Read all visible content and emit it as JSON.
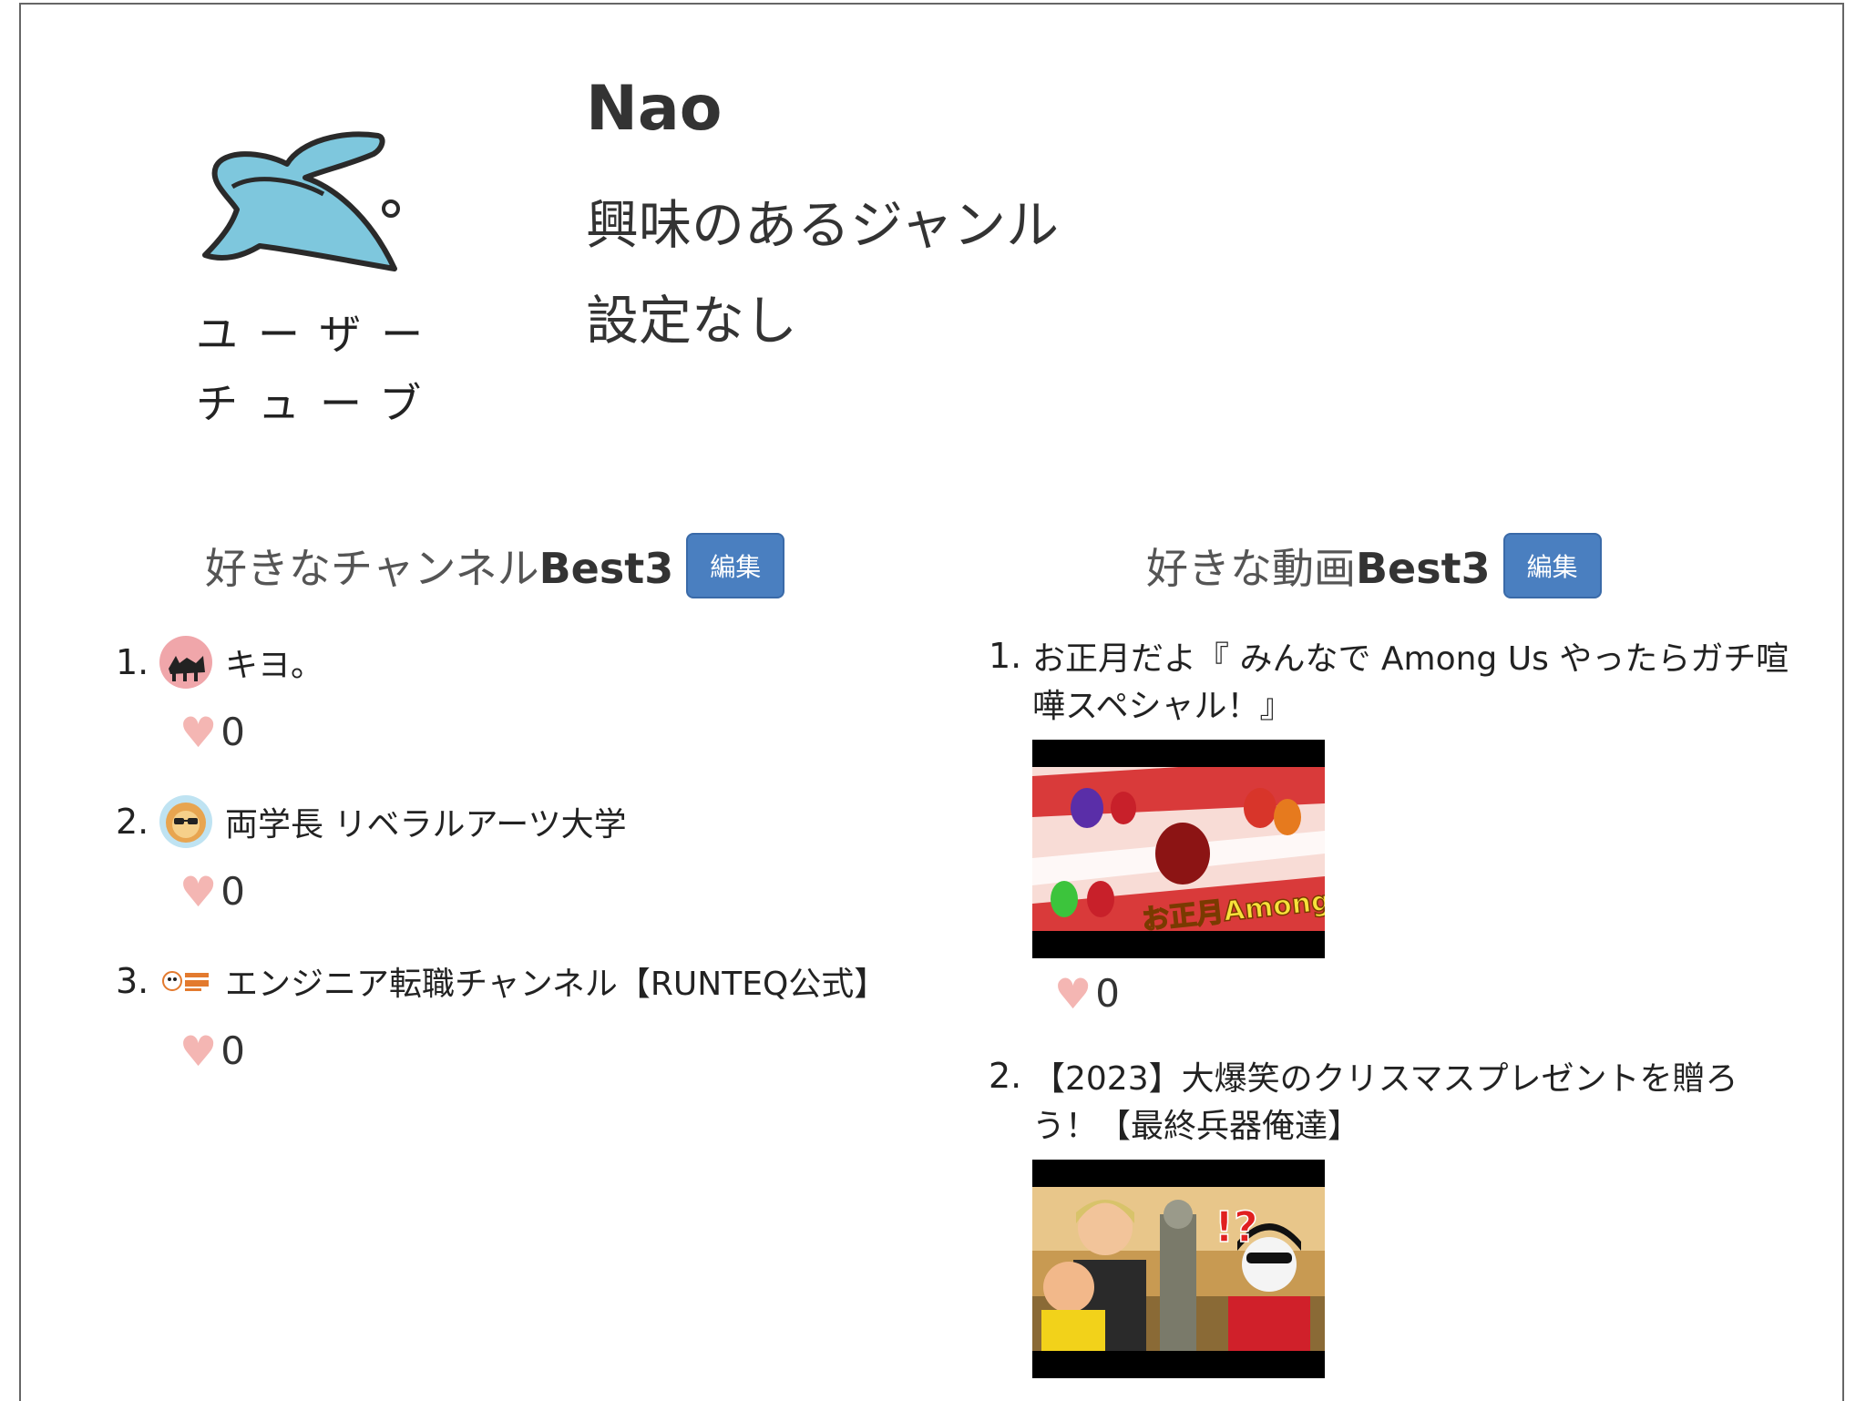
{
  "profile": {
    "logo_text_line1": "ユーザー",
    "logo_text_line2": "チューブ",
    "name": "Nao",
    "genre_label": "興味のあるジャンル",
    "genre_value": "設定なし"
  },
  "channels_section": {
    "title_prefix": "好きなチャンネル",
    "title_suffix": "Best3",
    "edit_label": "編集",
    "items": [
      {
        "num": "1.",
        "name": "キヨ。",
        "likes": "0",
        "avatar_icon": "cat-avatar-icon"
      },
      {
        "num": "2.",
        "name": "両学長 リベラルアーツ大学",
        "likes": "0",
        "avatar_icon": "lion-avatar-icon"
      },
      {
        "num": "3.",
        "name": "エンジニア転職チャンネル【RUNTEQ公式】",
        "likes": "0",
        "avatar_icon": "runteq-avatar-icon"
      }
    ]
  },
  "videos_section": {
    "title_prefix": "好きな動画",
    "title_suffix": "Best3",
    "edit_label": "編集",
    "items": [
      {
        "num": "1.",
        "title": "お正月だよ『 みんなで Among Us やったらガチ喧嘩スペシャル！』",
        "likes": "0",
        "thumb_caption": "お正月Among us"
      },
      {
        "num": "2.",
        "title": "【2023】大爆笑のクリスマスプレゼントを贈ろう！【最終兵器俺達】",
        "likes": "0",
        "thumb_caption": "!?"
      }
    ]
  },
  "colors": {
    "edit_button": "#4a7fc0",
    "heart": "#f4b6b3",
    "logo_rabbit": "#7ec7dd"
  }
}
